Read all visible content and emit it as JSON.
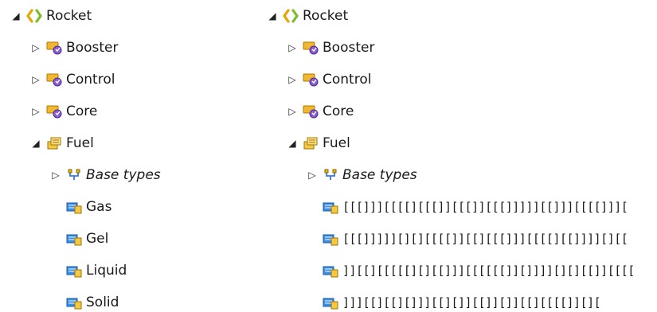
{
  "left_tree": {
    "root": "Rocket",
    "children": [
      "Booster",
      "Control",
      "Core"
    ],
    "fuel": "Fuel",
    "base_types": "Base types",
    "literals": [
      "Gas",
      "Gel",
      "Liquid",
      "Solid"
    ]
  },
  "right_tree": {
    "root": "Rocket",
    "children": [
      "Booster",
      "Control",
      "Core"
    ],
    "fuel": "Fuel",
    "base_types": "Base types",
    "literals": [
      "[[[]]][[[[][[[]][[[]][[[]]]]][[]]][[[[]]][",
      "[[[]]]]][][][[[[]][[][[[]]][[[[][[]]]][][[",
      "]][[][[[[[][][[]]][[[[[[]][]]]][][][[]][[[[",
      "]]][[][[][]]][[][]][[]][]][[][[[[]][]["
    ]
  },
  "icons": {
    "root": "package-icon",
    "class": "class-folder-icon",
    "fuel": "enum-icon",
    "base_types": "inheritance-icon",
    "literal": "enum-literal-icon"
  }
}
